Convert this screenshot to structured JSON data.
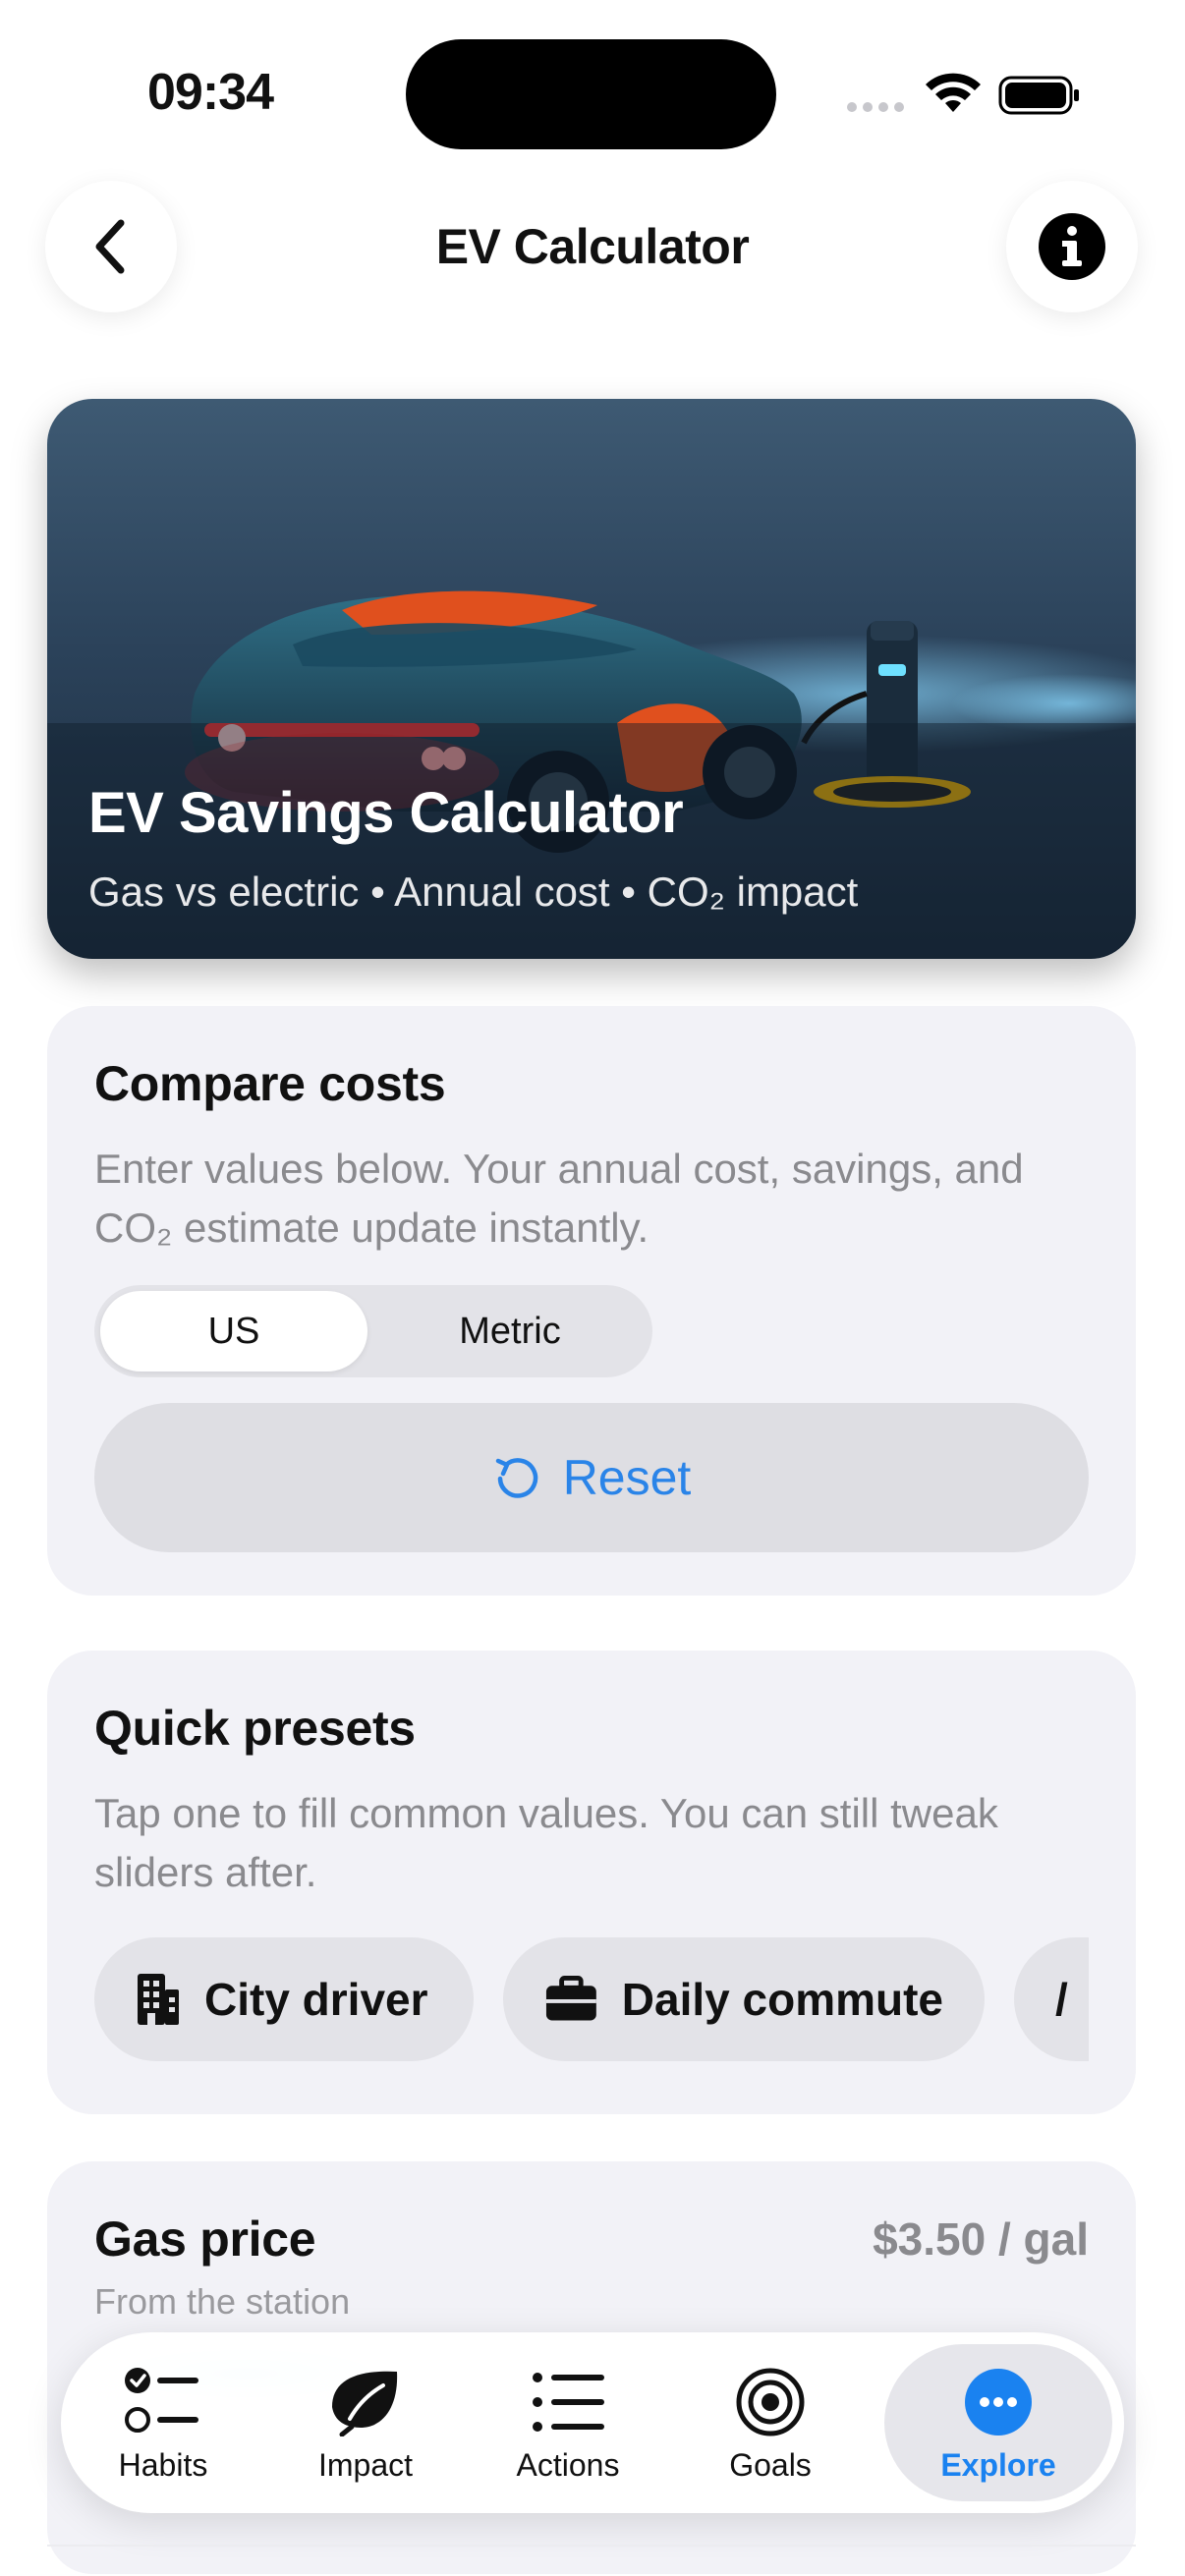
{
  "status": {
    "time": "09:34"
  },
  "nav": {
    "title": "EV Calculator",
    "back_icon": "chevron-left-icon",
    "info_icon": "info-icon"
  },
  "hero": {
    "title": "EV Savings Calculator",
    "subtitle": "Gas vs electric • Annual cost • CO₂ impact"
  },
  "compare": {
    "title": "Compare costs",
    "description": "Enter values below. Your annual cost, savings, and CO₂ estimate update instantly.",
    "units": {
      "options": [
        "US",
        "Metric"
      ],
      "selected": "US"
    },
    "reset_label": "Reset"
  },
  "presets": {
    "title": "Quick presets",
    "description": "Tap one to fill common values. You can still tweak sliders after.",
    "chips": [
      {
        "label": "City driver",
        "icon": "building-icon"
      },
      {
        "label": "Daily commute",
        "icon": "briefcase-icon"
      },
      {
        "label": "/",
        "icon": ""
      }
    ]
  },
  "gas_price": {
    "title": "Gas price",
    "value": "$3.50 / gal",
    "subtitle": "From the station"
  },
  "tabs": [
    {
      "label": "Habits",
      "icon": "checklist-icon",
      "active": false
    },
    {
      "label": "Impact",
      "icon": "leaf-icon",
      "active": false
    },
    {
      "label": "Actions",
      "icon": "list-icon",
      "active": false
    },
    {
      "label": "Goals",
      "icon": "target-icon",
      "active": false
    },
    {
      "label": "Explore",
      "icon": "more-icon",
      "active": true
    }
  ],
  "colors": {
    "accent": "#1a82f0",
    "card_bg": "#f2f2f7",
    "muted_text": "#8a8a8e"
  }
}
